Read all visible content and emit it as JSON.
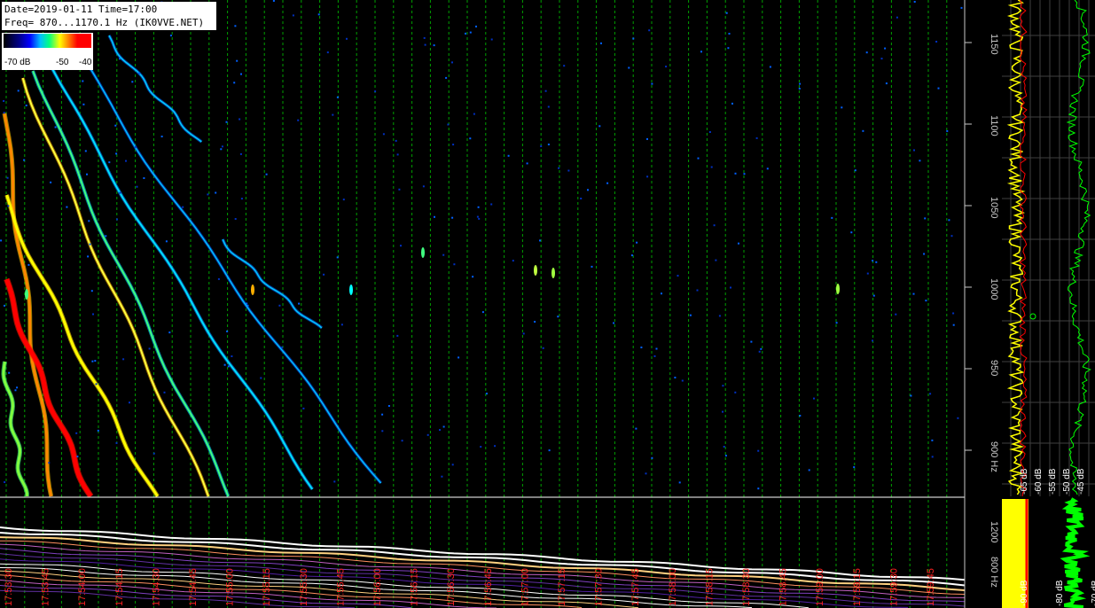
{
  "info": {
    "line1": "Date=2019-01-11 Time=17:00",
    "line2": "Freq= 870...1170.1 Hz (IK0VVE.NET)"
  },
  "legend": {
    "labels": [
      "-70 dB",
      "-50",
      "-40"
    ]
  },
  "freq_axis": {
    "labels": [
      "1150",
      "1100",
      "1050",
      "1000",
      "950",
      "900 Hz"
    ]
  },
  "lower_freq_axis": {
    "labels": [
      "1200",
      "800 Hz"
    ]
  },
  "time_axis": {
    "labels": [
      "17:53:30",
      "17:53:45",
      "17:54:00",
      "17:54:15",
      "17:54:30",
      "17:54:45",
      "17:55:00",
      "17:55:15",
      "17:55:30",
      "17:55:45",
      "17:56:00",
      "17:56:15",
      "17:56:30",
      "17:56:45",
      "17:57:00",
      "17:57:15",
      "17:57:30",
      "17:57:45",
      "17:58:00",
      "17:58:15",
      "17:58:30",
      "17:58:45",
      "17:59:00",
      "17:59:15",
      "17:59:30",
      "17:59:45"
    ]
  },
  "db_axis": {
    "labels": [
      "-65 dB",
      "-60 dB",
      "-55 dB",
      "-50 dB",
      "-45 dB"
    ]
  },
  "lower_db_axis": {
    "labels": [
      "-90 dB",
      "-80 dB",
      "-70 dB"
    ]
  },
  "colors": {
    "grid": "#00a000",
    "time_label": "#ff2020",
    "axis_text": "#c8c8c8",
    "yellow_trace": "#ffff00",
    "green_trace": "#00ff00",
    "red_trace": "#ff0000"
  }
}
